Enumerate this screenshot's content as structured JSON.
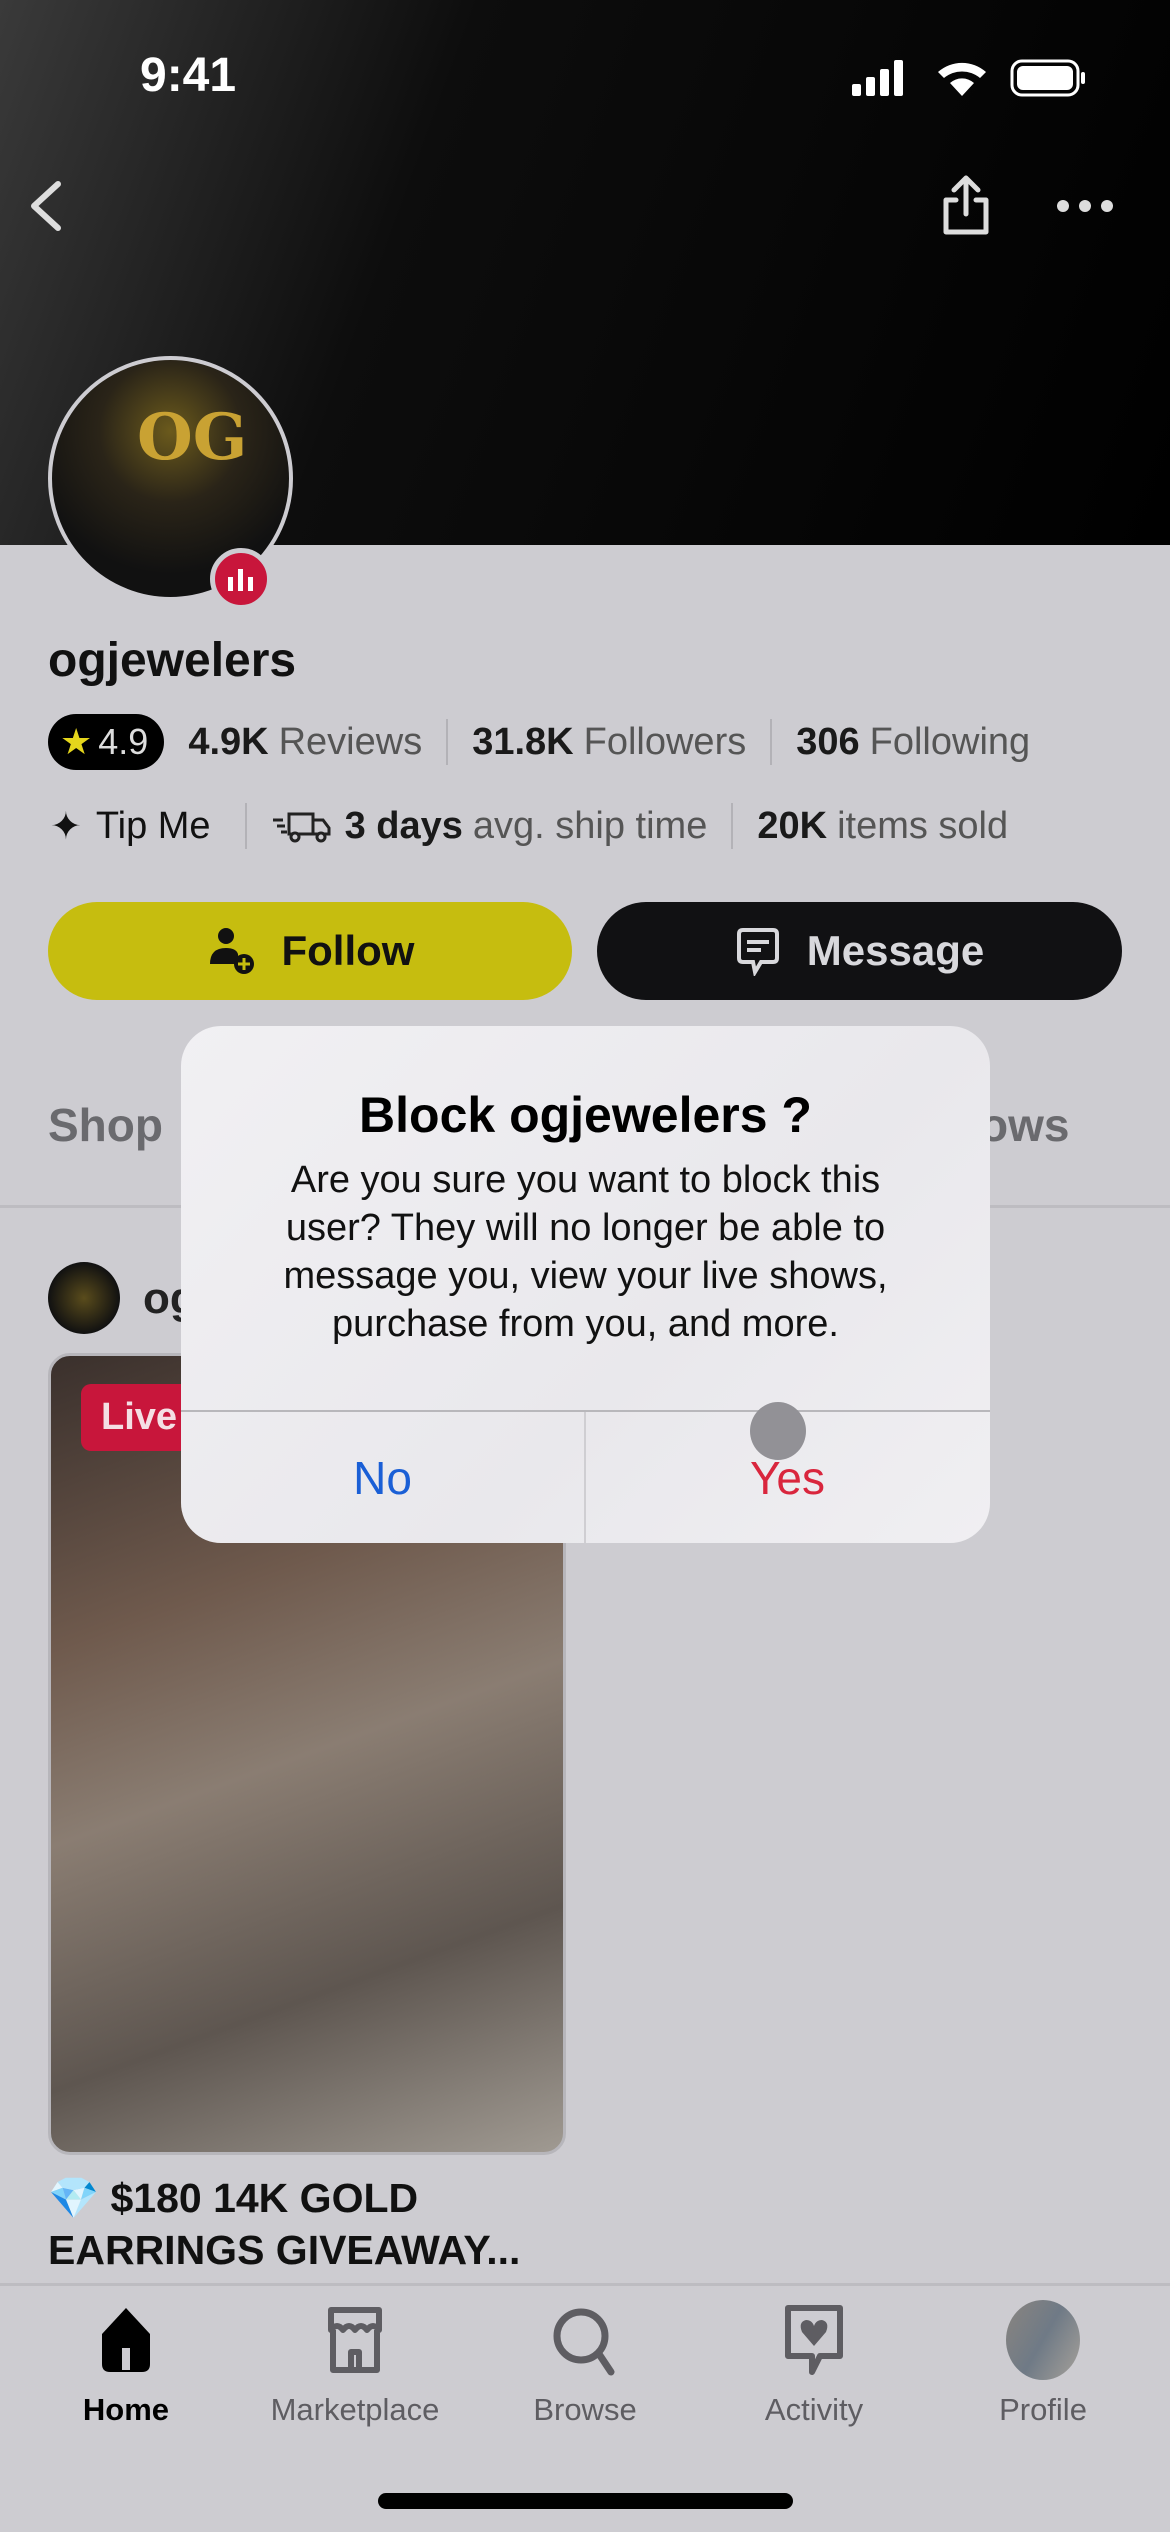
{
  "status_bar": {
    "time": "9:41"
  },
  "profile": {
    "username": "ogjewelers",
    "rating": "4.9",
    "reviews_count": "4.9K",
    "reviews_label": "Reviews",
    "followers_count": "31.8K",
    "followers_label": "Followers",
    "following_count": "306",
    "following_label": "Following",
    "tip_label": "Tip Me",
    "ship_value": "3 days",
    "ship_label": "avg. ship time",
    "sold_value": "20K",
    "sold_label": "items sold",
    "follow_label": "Follow",
    "message_label": "Message",
    "avatar_logo": "OG"
  },
  "tabs": {
    "left": "Shop",
    "right": "ows"
  },
  "post": {
    "user_partial": "og",
    "live_label": "Live",
    "title_line1": "$180 14K GOLD",
    "title_line2": "EARRINGS GIVEAWAY...",
    "emoji": "💎"
  },
  "dialog": {
    "title": "Block ogjewelers ?",
    "body": "Are you sure you want to block this user? They will no longer be able to message you, view your live shows, purchase from you, and more.",
    "no_label": "No",
    "yes_label": "Yes",
    "colors": {
      "no": "#1a5fd6",
      "yes": "#d9263d"
    }
  },
  "tabbar": {
    "items": [
      {
        "label": "Home",
        "active": true
      },
      {
        "label": "Marketplace"
      },
      {
        "label": "Browse"
      },
      {
        "label": "Activity"
      },
      {
        "label": "Profile"
      }
    ]
  },
  "colors": {
    "follow": "#c6bd0f",
    "message": "#111113",
    "live": "#c8163b"
  }
}
